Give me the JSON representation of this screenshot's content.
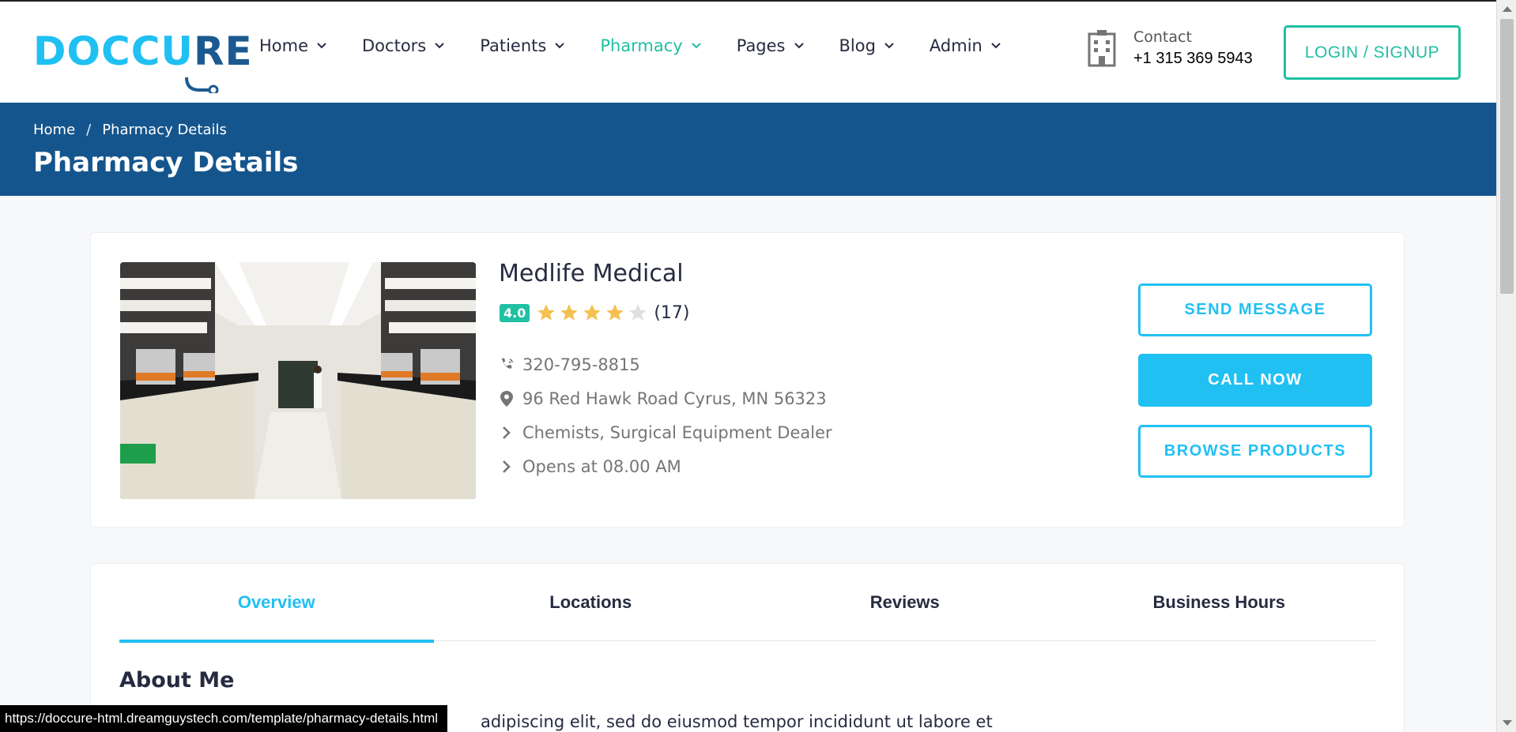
{
  "header": {
    "logo_text_a": "DOCC",
    "logo_text_b": "U",
    "logo_text_c": "RE",
    "nav": [
      {
        "label": "Home"
      },
      {
        "label": "Doctors"
      },
      {
        "label": "Patients"
      },
      {
        "label": "Pharmacy"
      },
      {
        "label": "Pages"
      },
      {
        "label": "Blog"
      },
      {
        "label": "Admin"
      }
    ],
    "contact_label": "Contact",
    "contact_phone": "+1 315 369 5943",
    "login_label": "LOGIN / SIGNUP"
  },
  "banner": {
    "breadcrumb_home": "Home",
    "breadcrumb_sep": "/",
    "breadcrumb_current": "Pharmacy Details",
    "title": "Pharmacy Details"
  },
  "pharmacy": {
    "name": "Medlife Medical",
    "rating": "4.0",
    "rating_value": 4,
    "rating_max": 5,
    "review_count": "(17)",
    "phone": "320-795-8815",
    "address": "96 Red Hawk Road Cyrus, MN 56323",
    "category": "Chemists, Surgical Equipment Dealer",
    "hours": "Opens at 08.00 AM",
    "send_message_label": "SEND MESSAGE",
    "call_now_label": "CALL NOW",
    "browse_products_label": "BROWSE PRODUCTS"
  },
  "tabs": [
    {
      "label": "Overview"
    },
    {
      "label": "Locations"
    },
    {
      "label": "Reviews"
    },
    {
      "label": "Business Hours"
    }
  ],
  "overview": {
    "about_title": "About Me",
    "about_text": "adipiscing elit, sed do eiusmod tempor incididunt ut labore et"
  },
  "statusbar": {
    "url": "https://doccure-html.dreamguystech.com/template/pharmacy-details.html"
  },
  "colors": {
    "accent": "#20c0f3",
    "green": "#20c0a3",
    "banner": "#15558d",
    "star": "#f4c150"
  }
}
